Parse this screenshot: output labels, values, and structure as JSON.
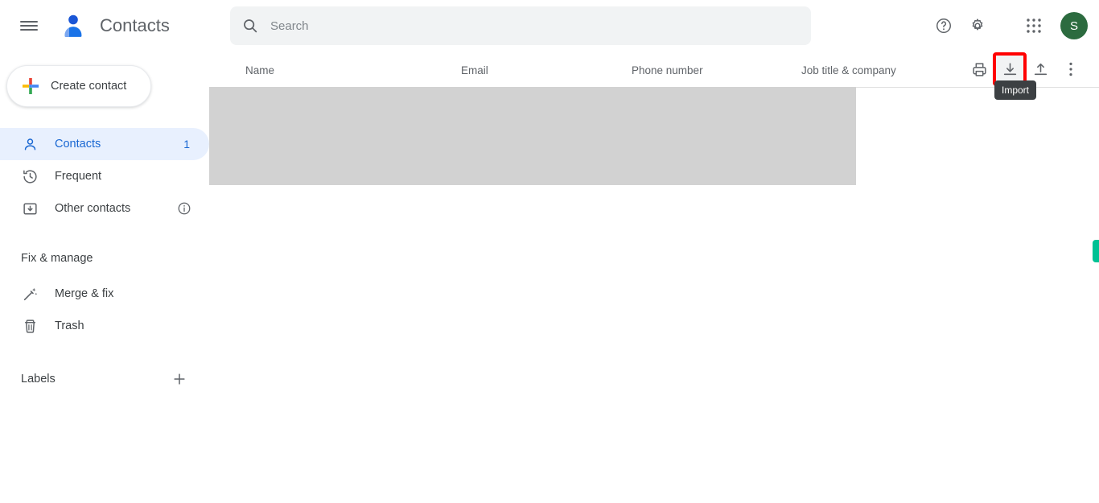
{
  "app": {
    "title": "Contacts",
    "logo_icon": "contacts-person-icon",
    "menu_icon": "hamburger-menu-icon"
  },
  "search": {
    "placeholder": "Search",
    "value": "",
    "icon": "search-icon"
  },
  "topbar_actions": [
    {
      "name": "help",
      "icon": "help-circle-icon",
      "label": "Support"
    },
    {
      "name": "settings",
      "icon": "gear-icon",
      "label": "Settings"
    },
    {
      "name": "apps",
      "icon": "grid-apps-icon",
      "label": "Google apps"
    }
  ],
  "account": {
    "initial": "S",
    "avatar_color": "#2c6b3f"
  },
  "sidebar": {
    "create_button": {
      "label": "Create contact",
      "icon": "google-plus-icon"
    },
    "items": [
      {
        "label": "Contacts",
        "icon": "person-icon",
        "count": "1",
        "active": true
      },
      {
        "label": "Frequent",
        "icon": "history-clock-icon",
        "count": "",
        "active": false
      },
      {
        "label": "Other contacts",
        "icon": "archive-box-icon",
        "count": "",
        "active": false,
        "info_icon": "info-circle-icon"
      }
    ],
    "fix_manage": {
      "title": "Fix & manage",
      "items": [
        {
          "label": "Merge & fix",
          "icon": "magic-wand-icon"
        },
        {
          "label": "Trash",
          "icon": "trash-icon"
        }
      ]
    },
    "labels": {
      "title": "Labels",
      "add_icon": "plus-icon"
    }
  },
  "table": {
    "columns": [
      "Name",
      "Email",
      "Phone number",
      "Job title & company"
    ],
    "rows": [],
    "actions": [
      {
        "name": "print",
        "icon": "printer-icon",
        "label": "Print"
      },
      {
        "name": "import",
        "icon": "download-arrow-icon",
        "label": "Import",
        "highlighted": true
      },
      {
        "name": "export",
        "icon": "upload-arrow-icon",
        "label": "Export"
      },
      {
        "name": "more",
        "icon": "more-vert-icon",
        "label": "More actions"
      }
    ]
  },
  "tooltip": {
    "text": "Import"
  },
  "colors": {
    "accent_blue": "#1967d2",
    "active_bg": "#e8f0fe",
    "highlight_red": "#ff0000",
    "scroll_marker": "#00c194",
    "placeholder_grey": "#d2d2d2"
  }
}
